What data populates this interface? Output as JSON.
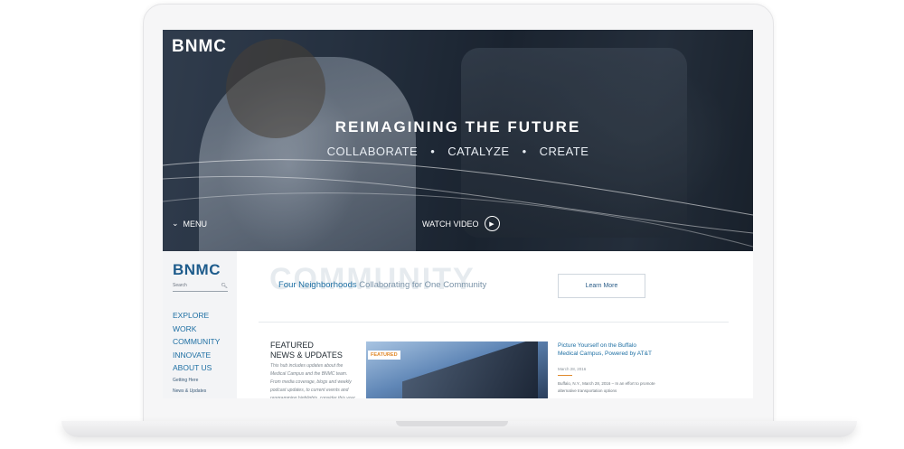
{
  "hero": {
    "logo": "BNMC",
    "title": "REIMAGINING THE FUTURE",
    "subtitle": [
      "COLLABORATE",
      "CATALYZE",
      "CREATE"
    ],
    "separator": "•",
    "menu_label": "MENU",
    "watch_video_label": "WATCH VIDEO"
  },
  "sidebar": {
    "logo": "BNMC",
    "search_placeholder": "Search",
    "nav": [
      "EXPLORE",
      "WORK",
      "COMMUNITY",
      "INNOVATE",
      "ABOUT US"
    ],
    "subnav": [
      "Getting Here",
      "News & Updates"
    ]
  },
  "community": {
    "background_word": "COMMUNITY",
    "tagline_strong": "Four Neighborhoods",
    "tagline_rest": " Collaborating for One Community",
    "button_label": "Learn More"
  },
  "featured": {
    "heading_line1": "FEATURED",
    "heading_line2": "NEWS & UPDATES",
    "description": "This hub includes updates about the Medical Campus and the BNMC team. From media coverage, blogs and weekly podcast updates, to current events and programming highlights, consider this your",
    "badge": "FEATURED"
  },
  "news": {
    "title": "Picture Yourself on the Buffalo Medical Campus, Powered by AT&T",
    "date": "March 28, 2016",
    "snippet": "Buffalo, N.Y., March 28, 2016 – In an effort to promote alternative transportation options"
  },
  "colors": {
    "brand_blue": "#1e6fa3",
    "accent_orange": "#e08a2c"
  }
}
